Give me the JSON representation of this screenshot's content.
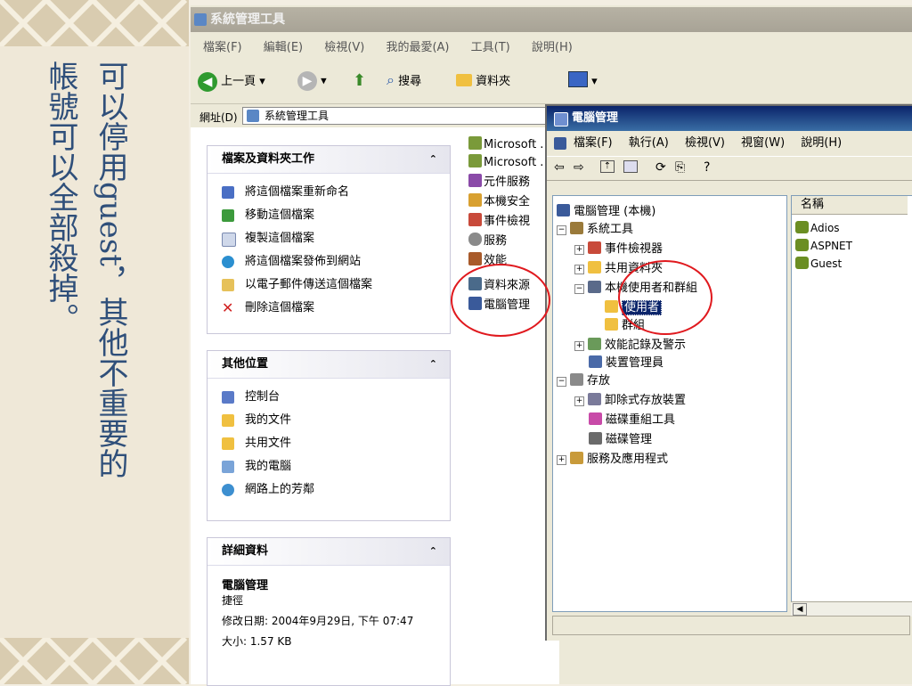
{
  "slide": {
    "vertical_text": [
      "可以停用guest，其他不重要的",
      "帳號可以全部殺掉。"
    ]
  },
  "explorer": {
    "title": "系統管理工具",
    "menu": [
      "檔案(F)",
      "編輯(E)",
      "檢視(V)",
      "我的最愛(A)",
      "工具(T)",
      "說明(H)"
    ],
    "toolbar": {
      "back": "上一頁",
      "search": "搜尋",
      "folders": "資料夾"
    },
    "address": {
      "label": "網址(D)",
      "value": "系統管理工具"
    },
    "panels": {
      "tasks": {
        "title": "檔案及資料夾工作",
        "items": [
          "將這個檔案重新命名",
          "移動這個檔案",
          "複製這個檔案",
          "將這個檔案發佈到網站",
          "以電子郵件傳送這個檔案",
          "刪除這個檔案"
        ]
      },
      "places": {
        "title": "其他位置",
        "items": [
          "控制台",
          "我的文件",
          "共用文件",
          "我的電腦",
          "網路上的芳鄰"
        ]
      },
      "details": {
        "title": "詳細資料",
        "name": "電腦管理",
        "type": "捷徑",
        "modified": "修改日期: 2004年9月29日, 下午 07:47",
        "size": "大小: 1.57 KB"
      }
    },
    "files": [
      "Microsoft .",
      "Microsoft .",
      "元件服務",
      "本機安全",
      "事件檢視",
      "服務",
      "效能",
      "資料來源",
      "電腦管理"
    ]
  },
  "computer_management": {
    "title": "電腦管理",
    "menu": [
      "檔案(F)",
      "執行(A)",
      "檢視(V)",
      "視窗(W)",
      "說明(H)"
    ],
    "tree": {
      "root": "電腦管理 (本機)",
      "system_tools": "系統工具",
      "event_viewer": "事件檢視器",
      "shared_folders": "共用資料夾",
      "local_users": "本機使用者和群組",
      "users": "使用者",
      "groups": "群組",
      "perf_logs": "效能記錄及警示",
      "device_manager": "裝置管理員",
      "storage": "存放",
      "removable": "卸除式存放裝置",
      "defrag": "磁碟重組工具",
      "disk_mgmt": "磁碟管理",
      "services_apps": "服務及應用程式"
    },
    "list_header": "名稱",
    "users": [
      "Adios",
      "ASPNET",
      "Guest"
    ]
  }
}
